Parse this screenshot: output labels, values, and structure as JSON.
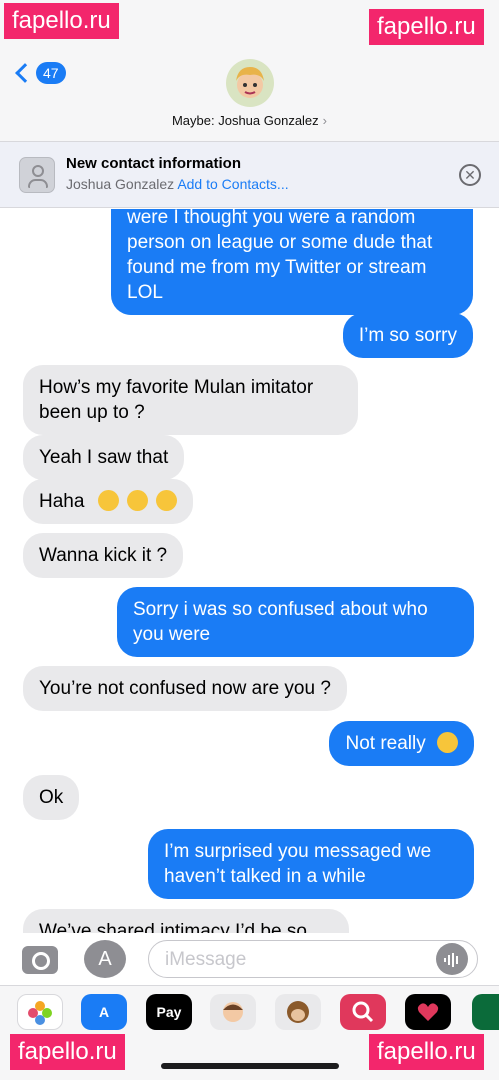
{
  "header": {
    "badge_count": "47",
    "contact_name": "Maybe: Joshua Gonzalez",
    "chevron": "›"
  },
  "banner": {
    "title": "New contact information",
    "subtitle_name": "Joshua Gonzalez",
    "link": "Add to Contacts...",
    "close_glyph": "✕"
  },
  "messages": [
    {
      "type": "sent",
      "text": "were I thought you were a random person on league or some dude that found me from my Twitter or stream LOL"
    },
    {
      "type": "sent",
      "text": "I’m so sorry"
    },
    {
      "type": "received",
      "text": "How’s my favorite Mulan imitator been up to ?"
    },
    {
      "type": "received",
      "text": "Yeah I saw that"
    },
    {
      "type": "received",
      "text": "Haha"
    },
    {
      "type": "received",
      "text": "Wanna kick it ?"
    },
    {
      "type": "sent",
      "text": "Sorry i was so confused about who you were"
    },
    {
      "type": "received",
      "text": "You’re not confused now are you ?"
    },
    {
      "type": "sent",
      "text": "Not really"
    },
    {
      "type": "received",
      "text": "Ok"
    },
    {
      "type": "sent",
      "text": "I’m surprised you messaged we haven’t talked in a while"
    },
    {
      "type": "received",
      "text": "We’ve shared intimacy I’d be so"
    }
  ],
  "emojis": {
    "haha": [
      "kissing-face-emoji",
      "heart-eyes-emoji",
      "winking-face-emoji"
    ],
    "not_really": "tears-of-joy-emoji"
  },
  "input": {
    "placeholder": "iMessage"
  },
  "apps": [
    {
      "name": "photos-app-icon",
      "label": "",
      "color": "#ffffff"
    },
    {
      "name": "app-store-app-icon",
      "label": "A",
      "color": "#1a7cf5"
    },
    {
      "name": "apple-pay-app-icon",
      "label": "Pay",
      "color": "#000000"
    },
    {
      "name": "memoji-app-icon",
      "label": "",
      "color": "#e9e9eb"
    },
    {
      "name": "monkey-emoji-app-icon",
      "label": "",
      "color": "#e9e9eb"
    },
    {
      "name": "web-search-app-icon",
      "label": "",
      "color": "#e0385c"
    },
    {
      "name": "digital-touch-app-icon",
      "label": "",
      "color": "#000000"
    },
    {
      "name": "starbucks-app-icon",
      "label": "",
      "color": "#0b6b3a"
    }
  ],
  "watermarks": [
    "fapello.ru",
    "fapello.ru",
    "fapello.ru",
    "fapello.ru"
  ],
  "colors": {
    "sent_bubble": "#1a7cf5",
    "received_bubble": "#e9e9eb",
    "watermark": "#f3266c"
  }
}
